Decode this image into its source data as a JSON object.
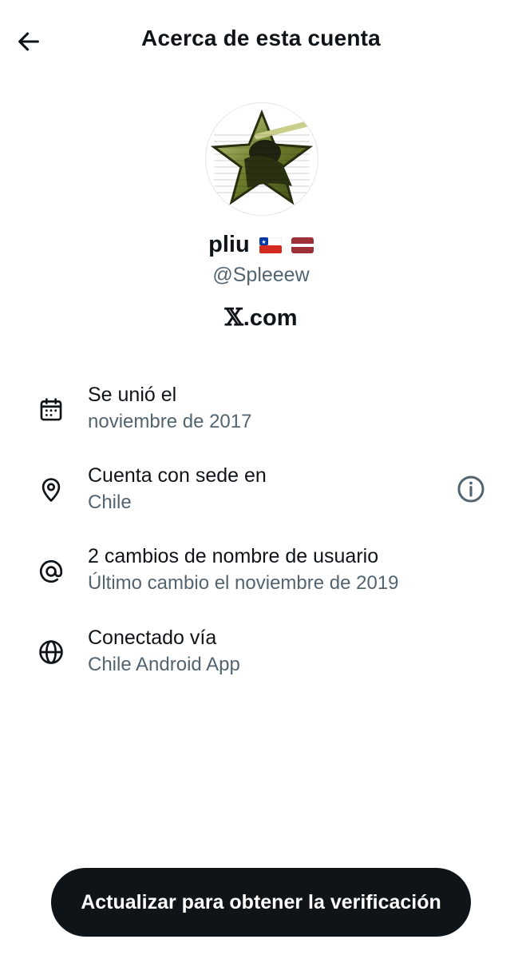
{
  "header": {
    "title": "Acerca de esta cuenta",
    "back_icon": "arrow-left-icon"
  },
  "profile": {
    "name": "pliu",
    "flags": [
      "chile-flag",
      "latvia-flag"
    ],
    "handle": "@Spleeew",
    "site_prefix": "𝕏",
    "site_suffix": ".com"
  },
  "details": [
    {
      "icon": "calendar-icon",
      "label": "Se unió el",
      "value": "noviembre de 2017"
    },
    {
      "icon": "location-pin-icon",
      "label": "Cuenta con sede en",
      "value": "Chile",
      "info_icon": "info-icon"
    },
    {
      "icon": "at-sign-icon",
      "label": "2 cambios de nombre de usuario",
      "value": "Último cambio el noviembre de 2019"
    },
    {
      "icon": "globe-icon",
      "label": "Conectado vía",
      "value": "Chile Android App"
    }
  ],
  "cta": {
    "label": "Actualizar para obtener la verificación"
  },
  "colors": {
    "text_primary": "#0f1419",
    "text_secondary": "#536471",
    "button_bg": "#0f1419",
    "button_text": "#ffffff"
  }
}
